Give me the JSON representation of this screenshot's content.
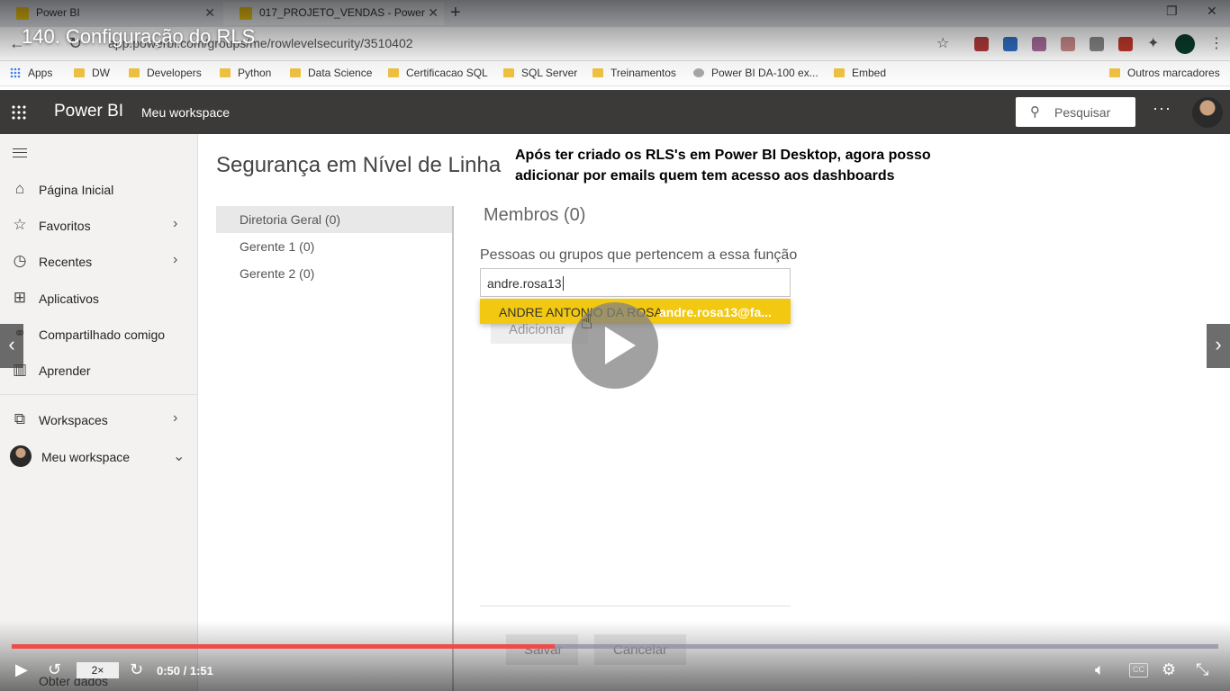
{
  "browser": {
    "tabs": [
      {
        "title": "Power BI"
      },
      {
        "title": "017_PROJETO_VENDAS - Power"
      }
    ],
    "url": "app.powerbi.com/groups/me/rowlevelsecurity/3510402",
    "bookmarks": [
      "Apps",
      "DW",
      "Developers",
      "Python",
      "Data Science",
      "Certificacao SQL",
      "SQL Server",
      "Treinamentos",
      "Power BI DA-100 ex...",
      "Embed"
    ],
    "other_bookmarks": "Outros marcadores"
  },
  "video": {
    "title": "140. Configuração do RLS",
    "speed": "2×",
    "time": "0:50 / 1:51",
    "progress": 0.45,
    "cc": "CC"
  },
  "header": {
    "brand": "Power BI",
    "workspace": "Meu workspace",
    "search_placeholder": "Pesquisar",
    "more": "···"
  },
  "sidebar": {
    "items": [
      {
        "label": "Página Inicial",
        "icon": "home-icon"
      },
      {
        "label": "Favoritos",
        "icon": "star-icon"
      },
      {
        "label": "Recentes",
        "icon": "clock-icon"
      },
      {
        "label": "Aplicativos",
        "icon": "apps-icon"
      },
      {
        "label": "Compartilhado comigo",
        "icon": "share-icon"
      },
      {
        "label": "Aprender",
        "icon": "book-icon"
      },
      {
        "label": "Workspaces",
        "icon": "workspaces-icon"
      },
      {
        "label": "Meu workspace",
        "icon": "avatar"
      }
    ],
    "bottom_item": "Obter dados"
  },
  "main": {
    "page_title": "Segurança em Nível de Linha",
    "annotation": "Após ter criado os RLS's em Power BI Desktop, agora posso adicionar por emails quem tem acesso aos dashboards",
    "roles": [
      "Diretoria Geral (0)",
      "Gerente 1 (0)",
      "Gerente 2 (0)"
    ],
    "members_title": "Membros (0)",
    "members_subtitle": "Pessoas ou grupos que pertencem a essa função",
    "member_input_value": "andre.rosa13",
    "suggestion_name": "ANDRE ANTONIO DA ROSA",
    "suggestion_email": "andre.rosa13@fa...",
    "add_button": "Adicionar",
    "save_button": "Salvar",
    "cancel_button": "Cancelar"
  },
  "colors": {
    "header_bg": "#3b3a39",
    "accent_yellow": "#f2c811",
    "progress_red": "#ee4b4b"
  }
}
